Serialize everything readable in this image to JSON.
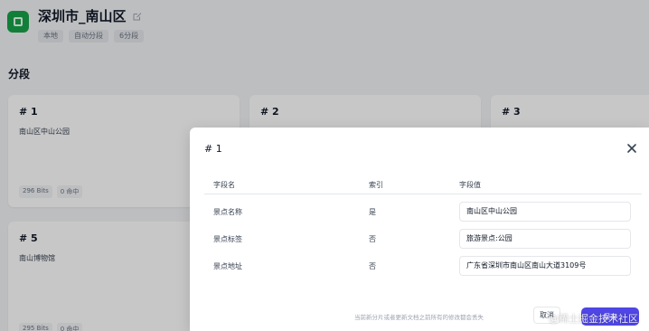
{
  "header": {
    "title": "深圳市_南山区",
    "tags": [
      "本地",
      "自动分段",
      "6分段"
    ]
  },
  "section": {
    "title": "分段"
  },
  "cards": [
    {
      "title": "# 1",
      "body": "南山区中山公园",
      "meta": [
        "296 Bits",
        "0 命中"
      ]
    },
    {
      "title": "# 2"
    },
    {
      "title": "# 3"
    },
    {
      "title": "# 5",
      "body": "南山博物馆",
      "meta": [
        "295 Bits",
        "0 命中"
      ]
    }
  ],
  "modal": {
    "title": "# 1",
    "columns": [
      "字段名",
      "索引",
      "字段值"
    ],
    "rows": [
      {
        "name": "景点名称",
        "index": "是",
        "value": "南山区中山公园"
      },
      {
        "name": "景点标签",
        "index": "否",
        "value": "旅游景点:公园"
      },
      {
        "name": "景点地址",
        "index": "否",
        "value": "广东省深圳市南山区南山大道3109号"
      }
    ],
    "footer_note": "当前新分片或者更新文档之前所有的修改都会丢失",
    "cancel_label": "取消",
    "save_label": "保存"
  },
  "watermark": "@稀土掘金技术社区",
  "colors": {
    "accent": "#4f46e5",
    "app_icon": "#16a34a"
  }
}
